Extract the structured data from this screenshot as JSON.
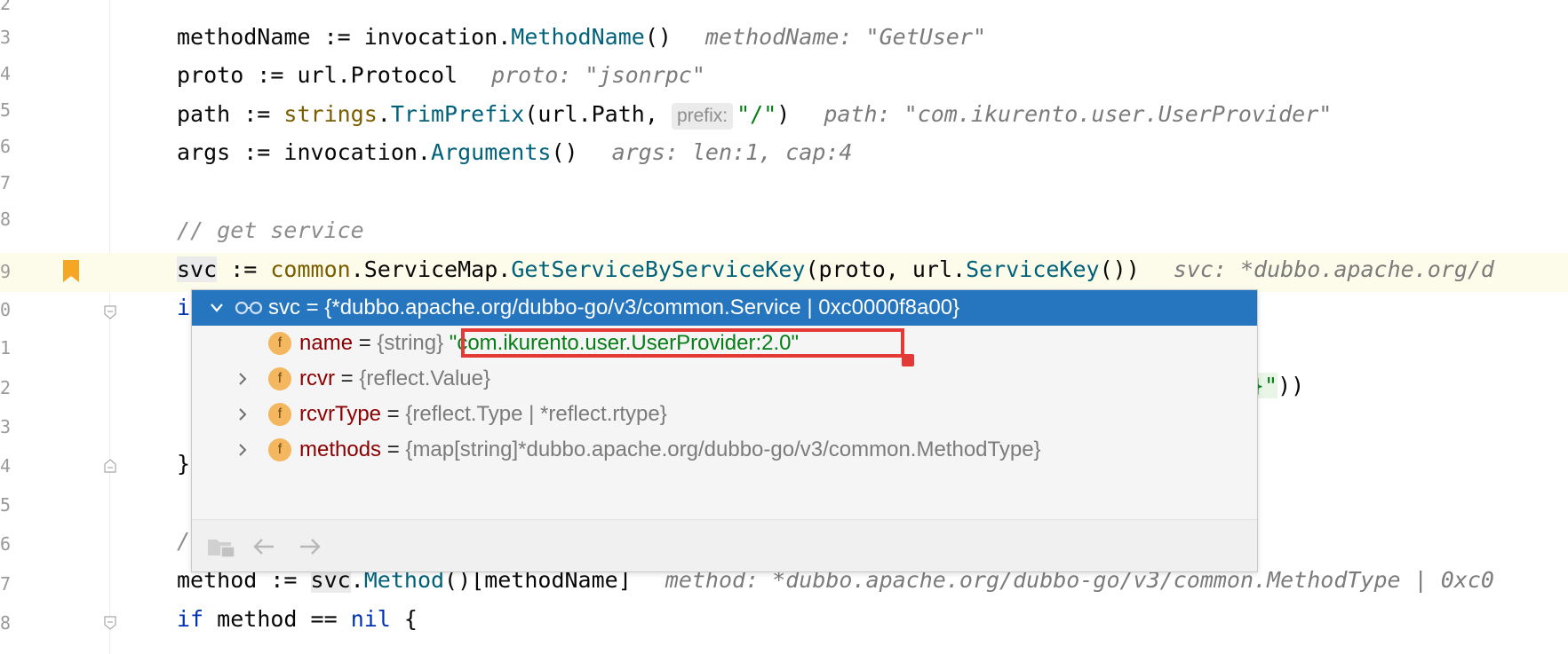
{
  "gutter": {
    "line_numbers": [
      "2",
      "3",
      "4",
      "5",
      "6",
      "7",
      "8",
      "9",
      "0",
      "1",
      "2",
      "3",
      "4",
      "5",
      "6",
      "7",
      "8"
    ]
  },
  "code": {
    "l93": {
      "a": "methodName := invocation.",
      "fn": "MethodName",
      "b": "()",
      "hint": "methodName: \"GetUser\""
    },
    "l94": {
      "a": "proto := url.Protocol",
      "hint": "proto: \"jsonrpc\""
    },
    "l95": {
      "a": "path := ",
      "pkg": "strings",
      "dot": ".",
      "fn": "TrimPrefix",
      "b": "(url.Path, ",
      "param": "prefix:",
      "str": "\"/\"",
      "c": ")",
      "hint": "path: \"com.ikurento.user.UserProvider\""
    },
    "l96": {
      "a": "args := invocation.",
      "fn": "Arguments",
      "b": "()",
      "hint": "args: len:1, cap:4"
    },
    "l98": {
      "comment": "// get service"
    },
    "l99": {
      "svc": "svc",
      "a": " := ",
      "pkg": "common",
      "b": ".ServiceMap.",
      "fn": "GetServiceByServiceKey",
      "c": "(proto, url.",
      "fn2": "ServiceKey",
      "d": "())",
      "hint": "svc: *dubbo.apache.org/d"
    },
    "l100": {
      "kw": "i"
    },
    "l102": {
      "tail_str": "}\"",
      "tail": "))"
    },
    "l104": {
      "text": "}"
    },
    "l106": {
      "text": "/"
    },
    "l107": {
      "a": "method := ",
      "svc": "svc",
      "b": ".",
      "fn": "Method",
      "c": "()[methodName]",
      "hint": "method: *dubbo.apache.org/dubbo-go/v3/common.MethodType | 0xc0"
    },
    "l108": {
      "kw": "if",
      "a": " method == ",
      "kw2": "nil",
      "b": " {"
    }
  },
  "popup": {
    "header": "svc = {*dubbo.apache.org/dubbo-go/v3/common.Service | 0xc0000f8a00}",
    "fields": [
      {
        "badge": "f",
        "name": "name",
        "eq": " = ",
        "type": "{string}",
        "value": "\"com.ikurento.user.UserProvider:2.0\"",
        "expandable": false
      },
      {
        "badge": "f",
        "name": "rcvr",
        "eq": " = ",
        "type": "{reflect.Value}",
        "value": "",
        "expandable": true
      },
      {
        "badge": "f",
        "name": "rcvrType",
        "eq": " = ",
        "type": "{reflect.Type | *reflect.rtype}",
        "value": "",
        "expandable": true
      },
      {
        "badge": "f",
        "name": "methods",
        "eq": " = ",
        "type": "{map[string]*dubbo.apache.org/dubbo-go/v3/common.MethodType}",
        "value": "",
        "expandable": true
      }
    ]
  },
  "icons": {
    "watch": "glasses-icon",
    "bookmark": "bookmark-icon",
    "fold": "fold-icon",
    "expand": "chevron-right-icon",
    "collapse": "chevron-down-icon",
    "open_in_window": "folder-window-icon",
    "back": "arrow-left-icon",
    "forward": "arrow-right-icon"
  },
  "colors": {
    "popup_header": "#2675bf",
    "highlight": "#e53935",
    "bookmark": "#f5a623",
    "field_badge": "#f4b65e"
  }
}
